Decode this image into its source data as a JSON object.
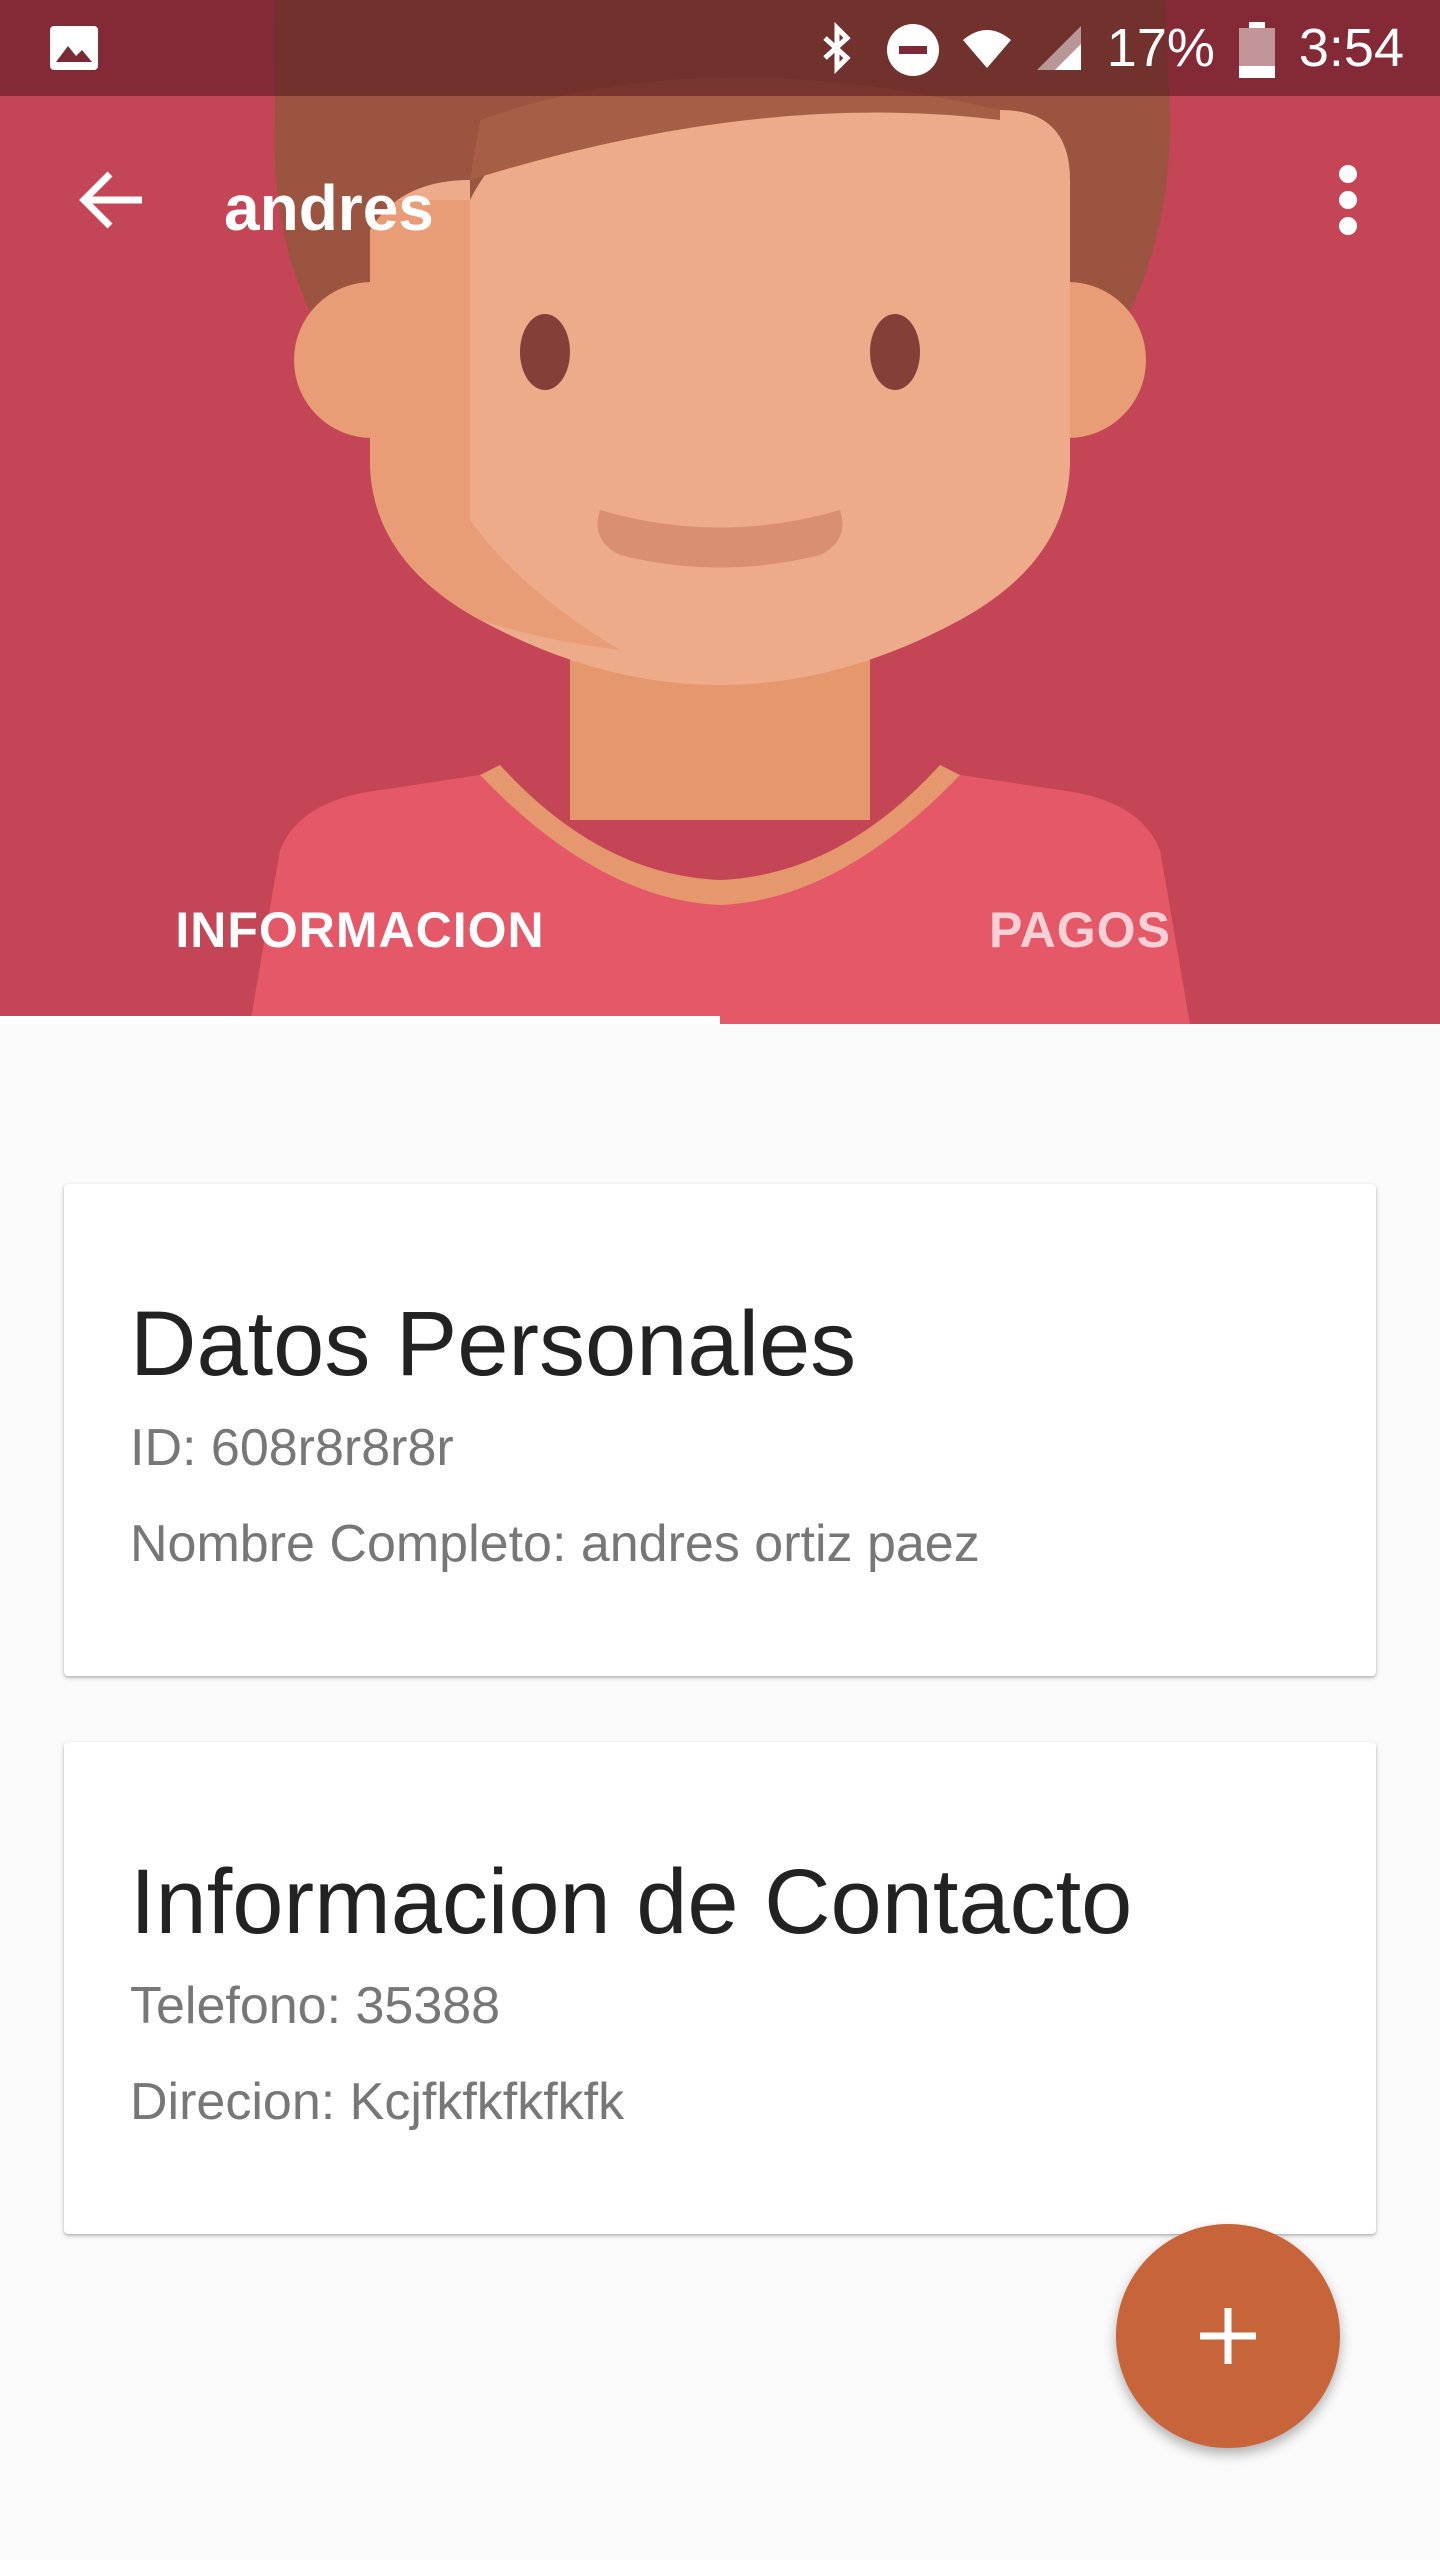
{
  "status_bar": {
    "battery_percent": "17%",
    "time": "3:54",
    "icons": [
      "image-icon",
      "bluetooth-icon",
      "do-not-disturb-icon",
      "wifi-icon",
      "signal-icon",
      "battery-icon"
    ]
  },
  "toolbar": {
    "title": "andres",
    "back_icon": "arrow-back-icon",
    "menu_icon": "more-vert-icon"
  },
  "tabs": [
    {
      "label": "INFORMACION",
      "active": true
    },
    {
      "label": "PAGOS",
      "active": false
    }
  ],
  "cards": {
    "personal": {
      "title": "Datos Personales",
      "id_line": "ID: 608r8r8r8r",
      "name_line": "Nombre Completo: andres ortiz paez"
    },
    "contact": {
      "title": "Informacion de Contacto",
      "phone_line": "Telefono: 35388",
      "address_line": "Direcion: Kcjfkfkfkfkfk"
    }
  },
  "fab": {
    "icon": "plus-icon"
  },
  "colors": {
    "header_bg": "#c44656",
    "fab": "#c8643a",
    "page_bg": "#fafafa"
  }
}
